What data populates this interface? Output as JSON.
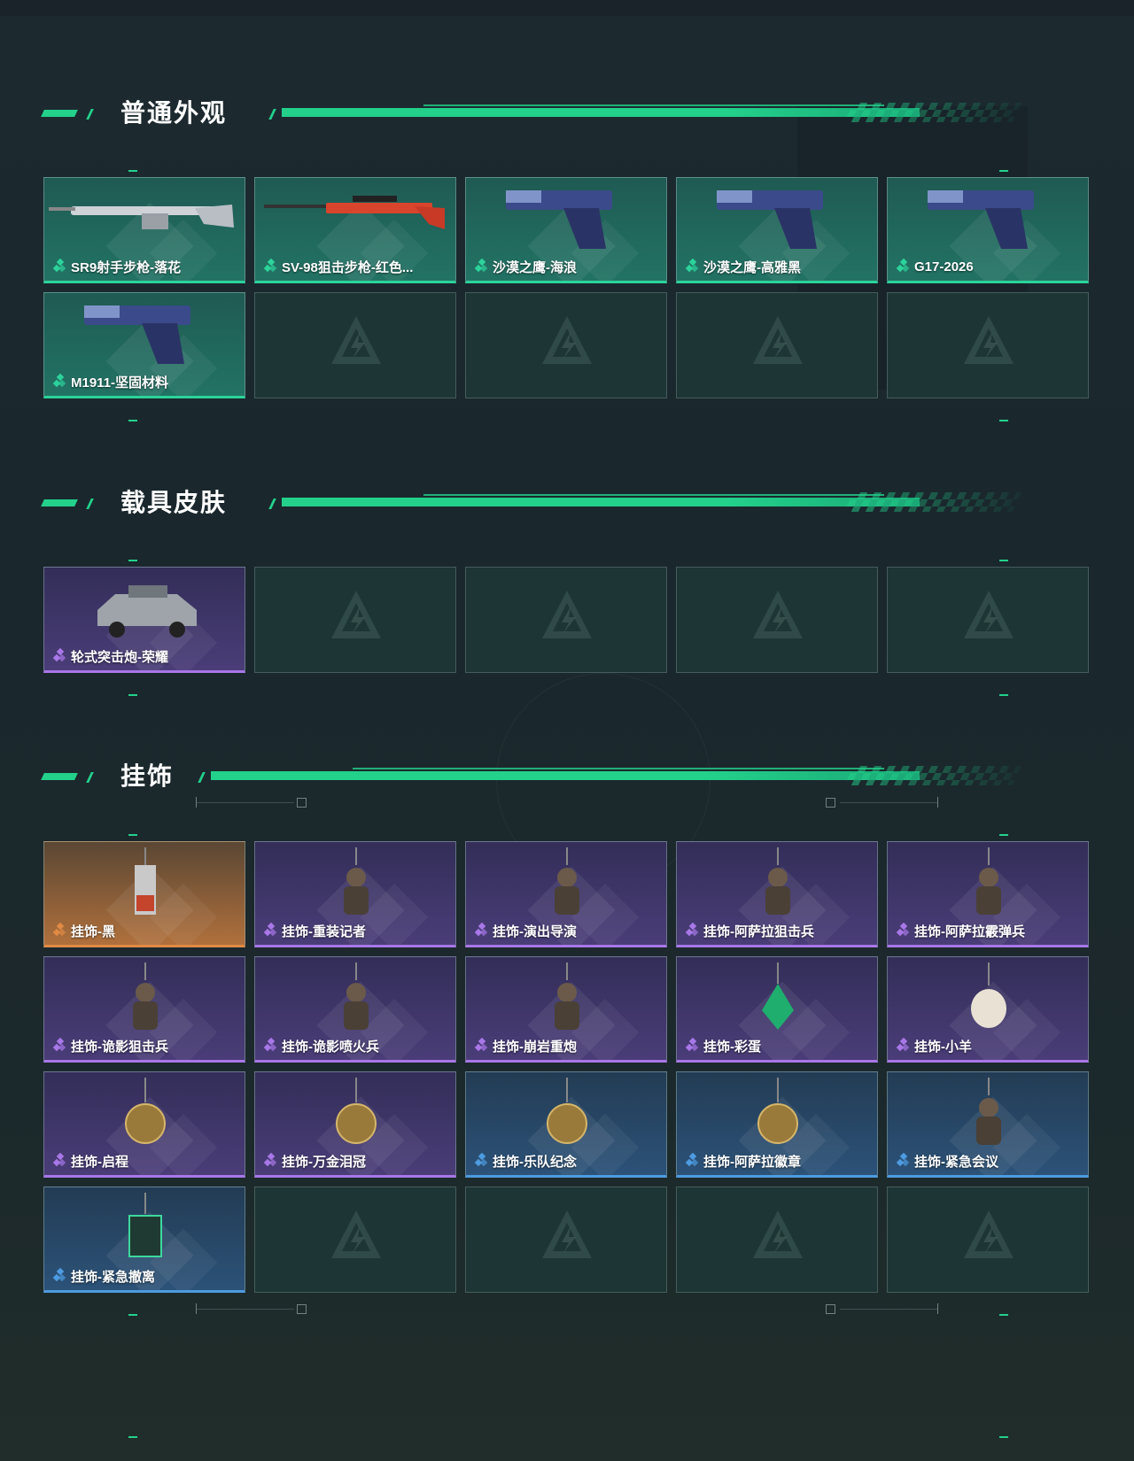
{
  "colors": {
    "accent": "#23d18b",
    "rarity_green": "#2cd39b",
    "rarity_purple": "#a877e8",
    "rarity_orange": "#e08a45",
    "rarity_blue": "#4d9be0"
  },
  "sections": [
    {
      "title": "普通外观",
      "items": [
        {
          "label": "SR9射手步枪-落花",
          "rarity": "green",
          "icon": "rifle-icon"
        },
        {
          "label": "SV-98狙击步枪-红色...",
          "rarity": "green",
          "icon": "sniper-rifle-icon"
        },
        {
          "label": "沙漠之鹰-海浪",
          "rarity": "green",
          "icon": "pistol-icon"
        },
        {
          "label": "沙漠之鹰-高雅黑",
          "rarity": "green",
          "icon": "pistol-icon"
        },
        {
          "label": "G17-2026",
          "rarity": "green",
          "icon": "pistol-icon"
        },
        {
          "label": "M1911-坚固材料",
          "rarity": "green",
          "icon": "pistol-icon"
        }
      ]
    },
    {
      "title": "载具皮肤",
      "items": [
        {
          "label": "轮式突击炮-荣耀",
          "rarity": "purple",
          "icon": "armored-vehicle-icon"
        }
      ]
    },
    {
      "title": "挂饰",
      "items": [
        {
          "label": "挂饰-黑",
          "rarity": "orange",
          "icon": "keychain-charm-icon"
        },
        {
          "label": "挂饰-重装记者",
          "rarity": "purple",
          "icon": "figure-charm-icon"
        },
        {
          "label": "挂饰-演出导演",
          "rarity": "purple",
          "icon": "figure-charm-icon"
        },
        {
          "label": "挂饰-阿萨拉狙击兵",
          "rarity": "purple",
          "icon": "figure-charm-icon"
        },
        {
          "label": "挂饰-阿萨拉霰弹兵",
          "rarity": "purple",
          "icon": "figure-charm-icon"
        },
        {
          "label": "挂饰-诡影狙击兵",
          "rarity": "purple",
          "icon": "figure-charm-icon"
        },
        {
          "label": "挂饰-诡影喷火兵",
          "rarity": "purple",
          "icon": "figure-charm-icon"
        },
        {
          "label": "挂饰-崩岩重炮",
          "rarity": "purple",
          "icon": "figure-charm-icon"
        },
        {
          "label": "挂饰-彩蛋",
          "rarity": "purple",
          "icon": "egg-charm-icon"
        },
        {
          "label": "挂饰-小羊",
          "rarity": "purple",
          "icon": "sheep-charm-icon"
        },
        {
          "label": "挂饰-启程",
          "rarity": "purple",
          "icon": "medal-charm-icon"
        },
        {
          "label": "挂饰-万金泪冠",
          "rarity": "purple",
          "icon": "coin-charm-icon"
        },
        {
          "label": "挂饰-乐队纪念",
          "rarity": "blue",
          "icon": "badge-charm-icon"
        },
        {
          "label": "挂饰-阿萨拉徽章",
          "rarity": "blue",
          "icon": "badge-charm-icon"
        },
        {
          "label": "挂饰-紧急会议",
          "rarity": "blue",
          "icon": "figure-charm-icon"
        },
        {
          "label": "挂饰-紧急撤离",
          "rarity": "blue",
          "icon": "box-charm-icon"
        }
      ]
    }
  ]
}
